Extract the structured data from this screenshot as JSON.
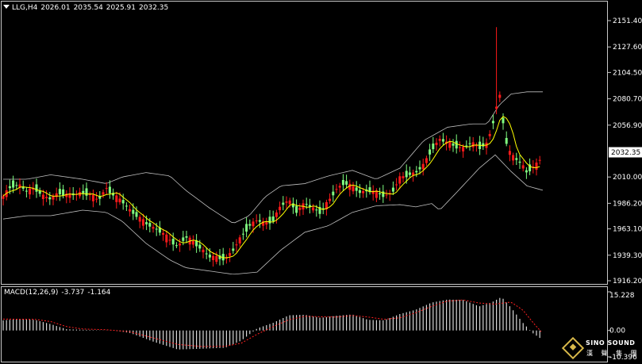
{
  "header": {
    "symbol": "LLG,H4",
    "open": "2026.01",
    "high": "2035.54",
    "low": "2025.91",
    "close": "2032.35"
  },
  "macd_header": {
    "label": "MACD(12,26,9)",
    "main": "-3.737",
    "signal": "-1.164"
  },
  "price_axis": {
    "ticks": [
      "2151.40",
      "2127.60",
      "2104.50",
      "2080.70",
      "2056.90",
      "2032.35",
      "2010.00",
      "1986.20",
      "1963.10",
      "1939.30",
      "1916.20"
    ],
    "current_price": "2032.35"
  },
  "macd_axis": {
    "ticks": [
      "15.228",
      "0.00",
      "-10.396"
    ]
  },
  "logo": {
    "title": "SINO SOUND",
    "subtitle": "漢 聲 集 團"
  },
  "colors": {
    "bull": "#ff1a1a",
    "bear": "#80ff80",
    "ma": "#ffff00",
    "bands": "#c0c0c0",
    "macd_hist": "#d8d8d8",
    "macd_signal": "#ff2020"
  },
  "chart_data": [
    {
      "type": "candlestick",
      "title": "LLG,H4",
      "ylim": [
        1916.2,
        2151.4
      ],
      "y_ticks": [
        2151.4,
        2127.6,
        2104.5,
        2080.7,
        2056.9,
        2032.35,
        2010.0,
        1986.2,
        1963.1,
        1939.3,
        1916.2
      ],
      "key_closes": [
        [
          0,
          1992
        ],
        [
          10,
          2002
        ],
        [
          20,
          2003
        ],
        [
          30,
          1997
        ],
        [
          40,
          2000
        ],
        [
          50,
          1993
        ],
        [
          60,
          1990
        ],
        [
          70,
          1996
        ],
        [
          80,
          1994
        ],
        [
          90,
          1994
        ],
        [
          100,
          1996
        ],
        [
          110,
          1994
        ],
        [
          120,
          1989
        ],
        [
          130,
          2000
        ],
        [
          140,
          1993
        ],
        [
          150,
          1988
        ],
        [
          160,
          1980
        ],
        [
          170,
          1974
        ],
        [
          180,
          1968
        ],
        [
          190,
          1964
        ],
        [
          200,
          1960
        ],
        [
          210,
          1953
        ],
        [
          220,
          1947
        ],
        [
          230,
          1956
        ],
        [
          240,
          1951
        ],
        [
          250,
          1945
        ],
        [
          260,
          1938
        ],
        [
          270,
          1937
        ],
        [
          280,
          1936
        ],
        [
          290,
          1944
        ],
        [
          300,
          1956
        ],
        [
          310,
          1966
        ],
        [
          320,
          1971
        ],
        [
          330,
          1968
        ],
        [
          340,
          1971
        ],
        [
          350,
          1984
        ],
        [
          360,
          1989
        ],
        [
          370,
          1979
        ],
        [
          380,
          1986
        ],
        [
          390,
          1982
        ],
        [
          400,
          1978
        ],
        [
          410,
          1988
        ],
        [
          420,
          1999
        ],
        [
          430,
          2005
        ],
        [
          440,
          2001
        ],
        [
          450,
          1996
        ],
        [
          460,
          1998
        ],
        [
          470,
          1996
        ],
        [
          480,
          1993
        ],
        [
          490,
          1996
        ],
        [
          500,
          2009
        ],
        [
          510,
          2012
        ],
        [
          520,
          2014
        ],
        [
          530,
          2021
        ],
        [
          540,
          2035
        ],
        [
          550,
          2044
        ],
        [
          560,
          2041
        ],
        [
          570,
          2038
        ],
        [
          580,
          2036
        ],
        [
          590,
          2041
        ],
        [
          600,
          2037
        ],
        [
          610,
          2040
        ],
        [
          620,
          2066
        ],
        [
          625,
          2088
        ],
        [
          630,
          2060
        ],
        [
          635,
          2038
        ],
        [
          640,
          2030
        ],
        [
          650,
          2024
        ],
        [
          655,
          2020
        ],
        [
          660,
          2014
        ],
        [
          665,
          2018
        ],
        [
          670,
          2020
        ],
        [
          675,
          2023
        ],
        [
          680,
          2032.35
        ]
      ],
      "spike": {
        "x": 624,
        "high": 2145.5
      },
      "bands_upper_keys": [
        [
          0,
          2008
        ],
        [
          30,
          2008
        ],
        [
          60,
          2012
        ],
        [
          100,
          2008
        ],
        [
          130,
          2004
        ],
        [
          150,
          2010
        ],
        [
          180,
          2014
        ],
        [
          210,
          2011
        ],
        [
          230,
          1998
        ],
        [
          260,
          1982
        ],
        [
          290,
          1968
        ],
        [
          310,
          1975
        ],
        [
          330,
          1992
        ],
        [
          350,
          2002
        ],
        [
          380,
          2004
        ],
        [
          410,
          2011
        ],
        [
          440,
          2016
        ],
        [
          470,
          2008
        ],
        [
          500,
          2018
        ],
        [
          530,
          2043
        ],
        [
          560,
          2055
        ],
        [
          590,
          2058
        ],
        [
          610,
          2058
        ],
        [
          625,
          2075
        ],
        [
          640,
          2085
        ],
        [
          660,
          2087
        ],
        [
          680,
          2087
        ]
      ],
      "bands_lower_keys": [
        [
          0,
          1972
        ],
        [
          30,
          1975
        ],
        [
          60,
          1975
        ],
        [
          100,
          1980
        ],
        [
          130,
          1978
        ],
        [
          150,
          1970
        ],
        [
          180,
          1950
        ],
        [
          210,
          1935
        ],
        [
          230,
          1928
        ],
        [
          260,
          1925
        ],
        [
          290,
          1922
        ],
        [
          320,
          1924
        ],
        [
          350,
          1944
        ],
        [
          380,
          1960
        ],
        [
          410,
          1966
        ],
        [
          440,
          1978
        ],
        [
          470,
          1984
        ],
        [
          500,
          1985
        ],
        [
          520,
          1983
        ],
        [
          540,
          1986
        ],
        [
          550,
          1980
        ],
        [
          570,
          1995
        ],
        [
          600,
          2018
        ],
        [
          620,
          2030
        ],
        [
          640,
          2015
        ],
        [
          660,
          2002
        ],
        [
          680,
          1998
        ]
      ]
    },
    {
      "type": "bar",
      "title": "MACD(12,26,9)",
      "ylim": [
        -10.396,
        15.228
      ],
      "y_ticks": [
        15.228,
        0.0,
        -10.396
      ],
      "macd_keys": [
        [
          0,
          4
        ],
        [
          20,
          4.5
        ],
        [
          40,
          4.2
        ],
        [
          60,
          2.5
        ],
        [
          80,
          0.5
        ],
        [
          100,
          0.3
        ],
        [
          120,
          0.1
        ],
        [
          140,
          0
        ],
        [
          160,
          -1
        ],
        [
          190,
          -4.5
        ],
        [
          220,
          -7.5
        ],
        [
          250,
          -7.2
        ],
        [
          280,
          -6.8
        ],
        [
          300,
          -4
        ],
        [
          320,
          0.8
        ],
        [
          340,
          3
        ],
        [
          360,
          6
        ],
        [
          380,
          6.2
        ],
        [
          400,
          5
        ],
        [
          420,
          5.8
        ],
        [
          440,
          6.3
        ],
        [
          460,
          4.2
        ],
        [
          480,
          4
        ],
        [
          500,
          6.5
        ],
        [
          520,
          8.2
        ],
        [
          540,
          11
        ],
        [
          560,
          12.2
        ],
        [
          580,
          12
        ],
        [
          600,
          9.5
        ],
        [
          615,
          11
        ],
        [
          628,
          13.2
        ],
        [
          640,
          9
        ],
        [
          655,
          3
        ],
        [
          668,
          -1.2
        ],
        [
          680,
          -3.737
        ]
      ],
      "signal_keys": [
        [
          0,
          4.5
        ],
        [
          40,
          4.4
        ],
        [
          60,
          3.5
        ],
        [
          80,
          1.5
        ],
        [
          100,
          0.6
        ],
        [
          130,
          0.3
        ],
        [
          160,
          -0.5
        ],
        [
          190,
          -3
        ],
        [
          220,
          -5.5
        ],
        [
          250,
          -6.3
        ],
        [
          280,
          -6.2
        ],
        [
          300,
          -5
        ],
        [
          320,
          -1.5
        ],
        [
          340,
          1.5
        ],
        [
          360,
          4.2
        ],
        [
          380,
          5.6
        ],
        [
          400,
          5.4
        ],
        [
          420,
          5.3
        ],
        [
          440,
          5.9
        ],
        [
          460,
          5.3
        ],
        [
          480,
          4.4
        ],
        [
          500,
          5
        ],
        [
          520,
          7
        ],
        [
          540,
          9.5
        ],
        [
          560,
          11.6
        ],
        [
          580,
          12
        ],
        [
          600,
          10.8
        ],
        [
          620,
          10.4
        ],
        [
          640,
          11.2
        ],
        [
          655,
          8
        ],
        [
          668,
          3
        ],
        [
          680,
          -1.164
        ]
      ]
    }
  ]
}
